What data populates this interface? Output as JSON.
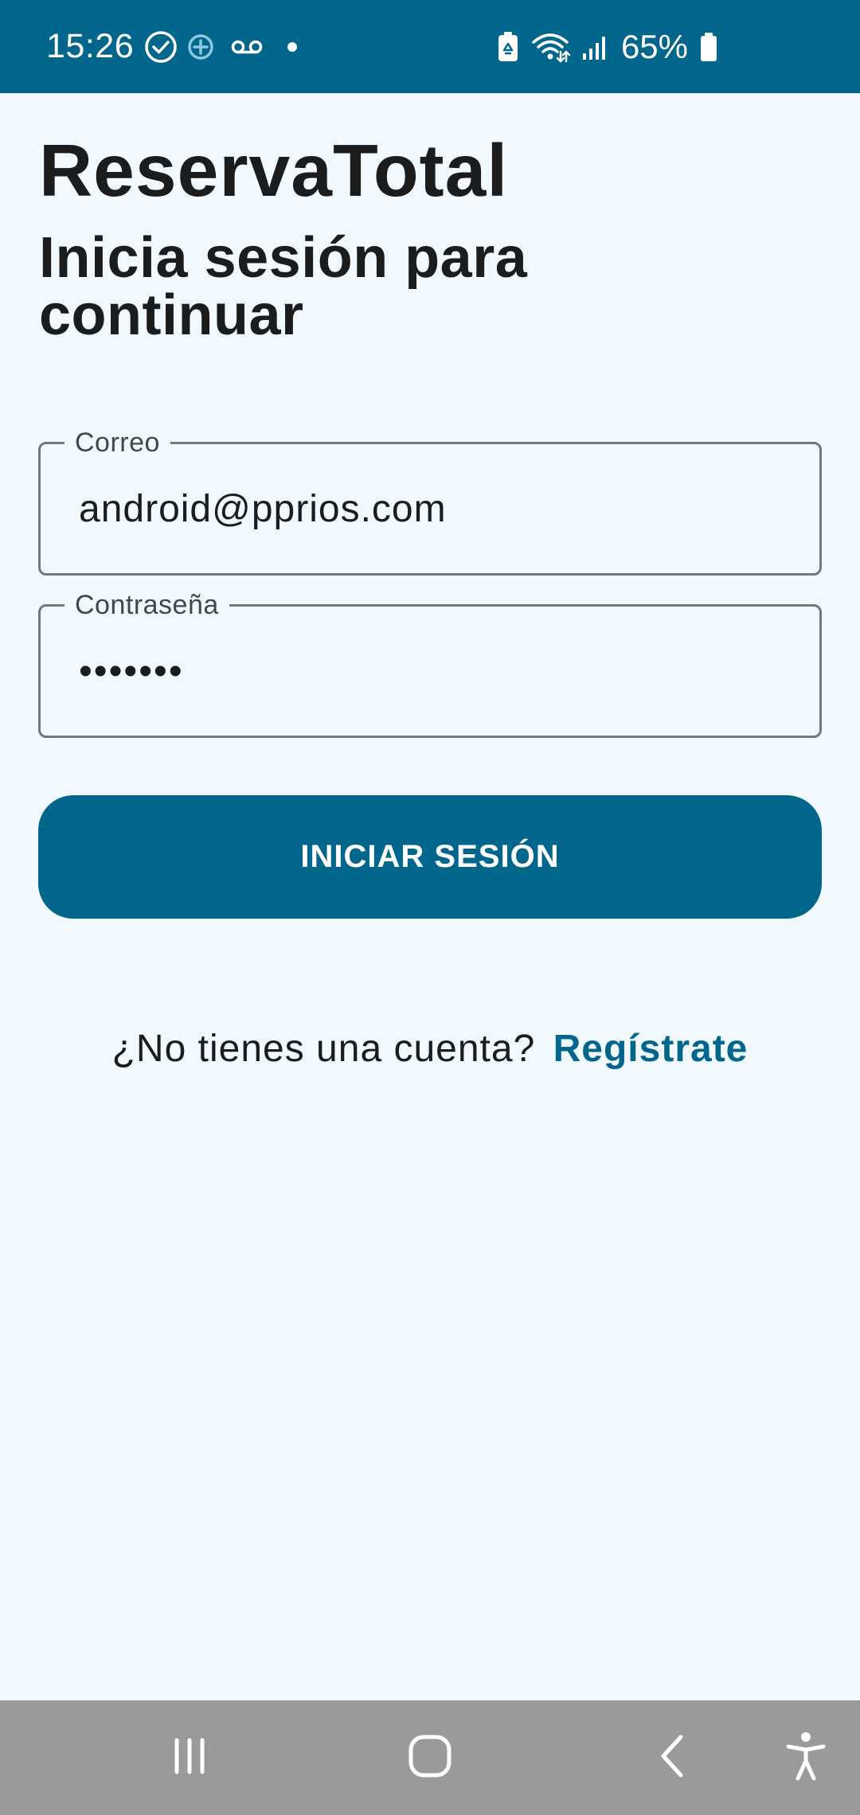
{
  "status_bar": {
    "time": "15:26",
    "battery_percent": "65%",
    "left_icons": [
      "check-circle-icon",
      "add-circle-icon",
      "voicemail-icon",
      "dot-icon"
    ],
    "right_icons": [
      "battery-saver-icon",
      "wifi-icon",
      "signal-icon",
      "battery-icon"
    ]
  },
  "app": {
    "title": "ReservaTotal",
    "subtitle": "Inicia sesión para continuar"
  },
  "form": {
    "email": {
      "label": "Correo",
      "value": "android@pprios.com"
    },
    "password": {
      "label": "Contraseña",
      "value": "•••••••"
    },
    "submit_label": "INICIAR SESIÓN"
  },
  "register": {
    "prompt": "¿No tienes una cuenta?",
    "link_label": "Regístrate"
  },
  "nav_bar": {
    "buttons": [
      "recent-apps-icon",
      "home-icon",
      "back-icon",
      "accessibility-icon"
    ]
  },
  "colors": {
    "primary": "#00668b",
    "background": "#f1f9ff",
    "nav_bar": "#9a9a9b",
    "outline": "#72787e"
  }
}
